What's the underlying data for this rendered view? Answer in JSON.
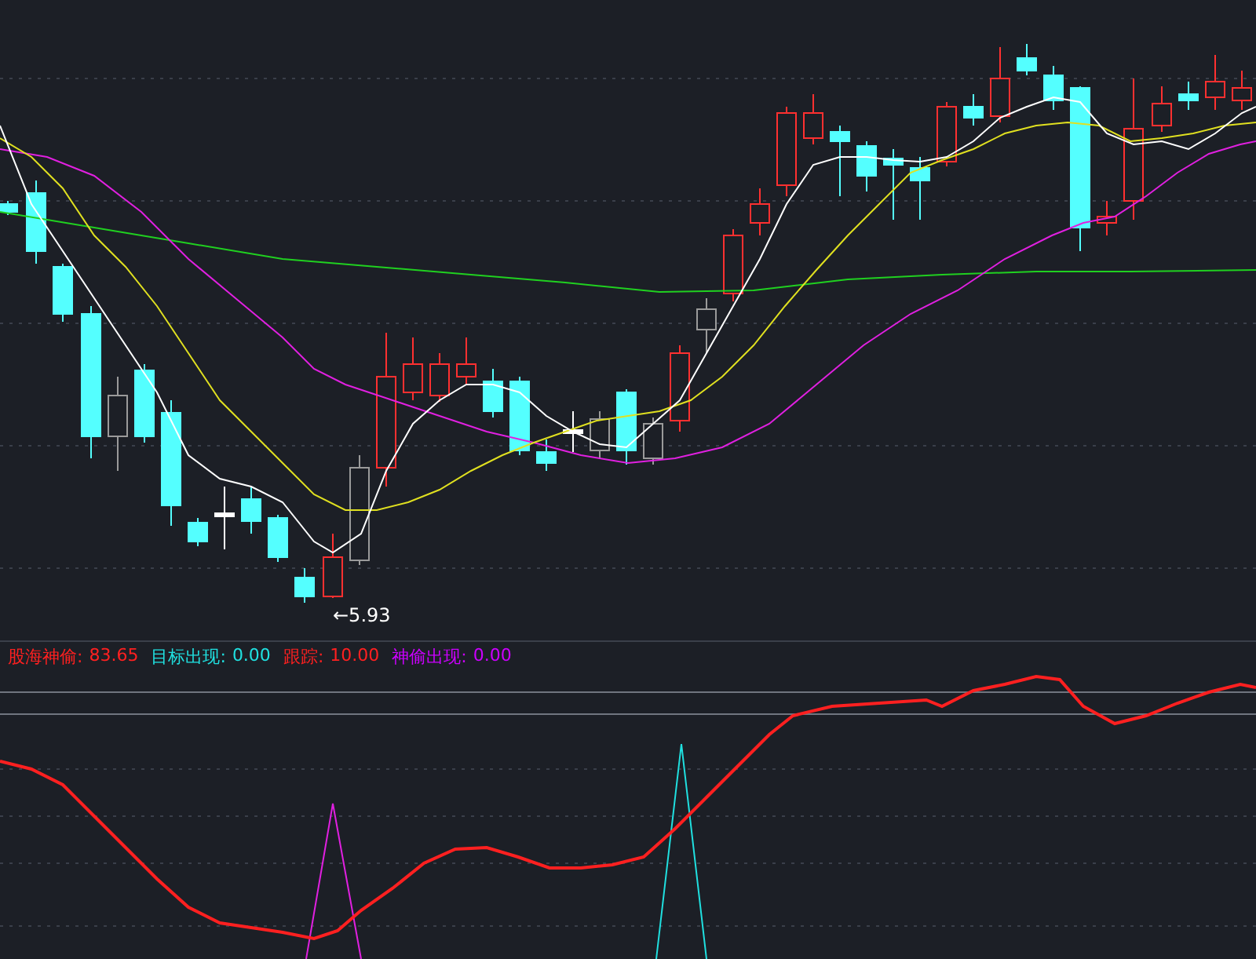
{
  "price_chart": {
    "low_marker": "←5.93"
  },
  "indicator_legend": [
    {
      "label": "股海神偷:",
      "value": "83.65",
      "color": "#ff2020"
    },
    {
      "label": "目标出现:",
      "value": "0.00",
      "color": "#20e0e0"
    },
    {
      "label": "跟踪:",
      "value": "10.00",
      "color": "#ff2020"
    },
    {
      "label": "神偷出现:",
      "value": "0.00",
      "color": "#cc00ff"
    }
  ]
}
